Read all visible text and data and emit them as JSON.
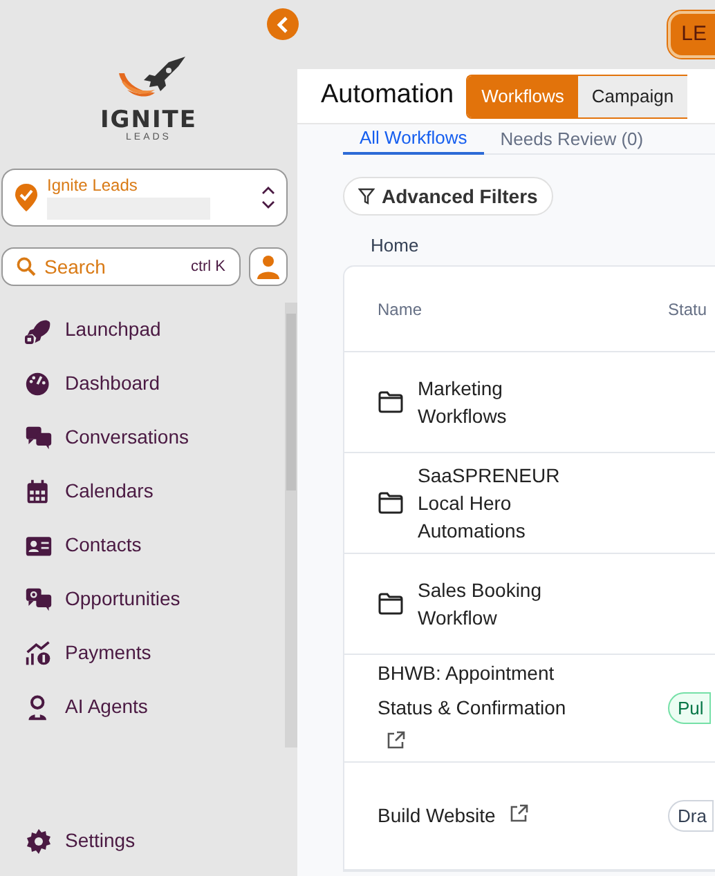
{
  "sidebar": {
    "brand": {
      "name": "IGNITE",
      "tagline": "LEADS"
    },
    "account": {
      "name": "Ignite Leads"
    },
    "search": {
      "placeholder": "Search",
      "shortcut": "ctrl K"
    },
    "items": [
      {
        "label": "Launchpad"
      },
      {
        "label": "Dashboard"
      },
      {
        "label": "Conversations"
      },
      {
        "label": "Calendars"
      },
      {
        "label": "Contacts"
      },
      {
        "label": "Opportunities"
      },
      {
        "label": "Payments"
      },
      {
        "label": "AI Agents"
      }
    ],
    "footer_item": {
      "label": "Settings"
    }
  },
  "topbar": {
    "button": "LE"
  },
  "header": {
    "title": "Automation",
    "tabs": [
      {
        "label": "Workflows",
        "selected": true
      },
      {
        "label": "Campaign",
        "selected": false
      }
    ]
  },
  "subtabs": [
    {
      "label": "All Workflows",
      "selected": true
    },
    {
      "label": "Needs Review (0)",
      "selected": false
    }
  ],
  "filter_button": "Advanced Filters",
  "breadcrumb": "Home",
  "table": {
    "columns": [
      "Name",
      "Statu"
    ],
    "rows": [
      {
        "kind": "folder",
        "name": "Marketing Workflows"
      },
      {
        "kind": "folder",
        "name": "SaaSPRENEUR Local Hero Automations"
      },
      {
        "kind": "folder",
        "name": "Sales Booking Workflow"
      },
      {
        "kind": "workflow",
        "name": "BHWB: Appointment Status & Confirmation",
        "status": {
          "label": "Pul",
          "kind": "published"
        }
      },
      {
        "kind": "workflow",
        "name": "Build Website",
        "status": {
          "label": "Dra",
          "kind": "draft"
        }
      }
    ]
  }
}
